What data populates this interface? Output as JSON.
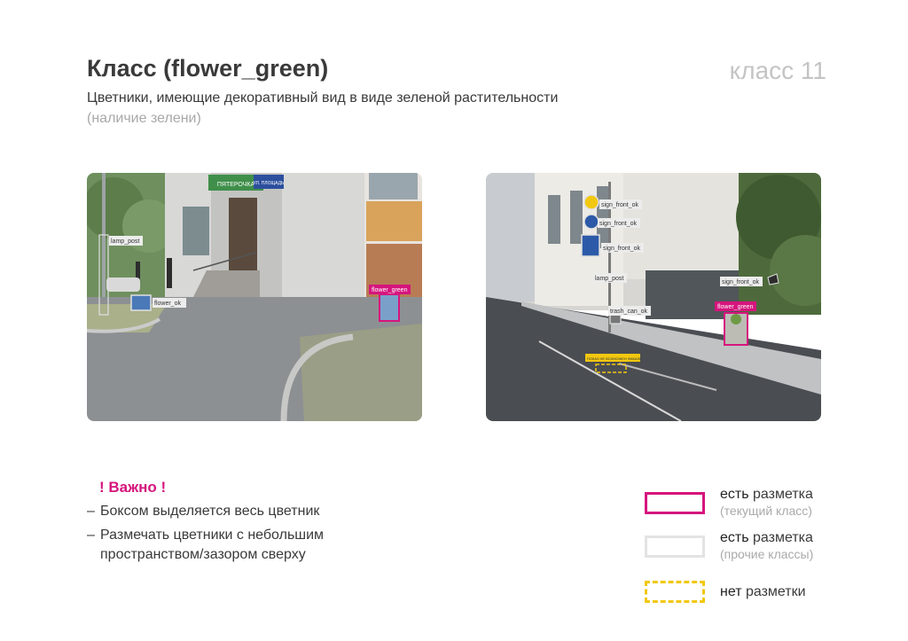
{
  "header": {
    "title": "Класс (flower_green)",
    "class_number": "класс 11",
    "subtitle": "Цветники, имеющие декоративный вид в виде зеленой растительности",
    "note": "(наличие зелени)"
  },
  "photos": {
    "left": {
      "labels": {
        "lamp_post": "lamp_post",
        "flower_ok": "flower_ok",
        "flower_green": "flower_green",
        "store_sign": "ПЯТЕРОЧКА",
        "street_plate": "УЛ. ПЛОЩАДЬ"
      }
    },
    "right": {
      "labels": {
        "sign1": "sign_front_ok",
        "sign2": "sign_front_ok",
        "sign3": "sign_front_ok",
        "sign4": "sign_front_ok",
        "lamp_post": "lamp_post",
        "trash": "trash_can_ok",
        "flower_green": "flower_green",
        "road_sign": "ПОКАЗ НЕ ВОЗМОЖЕН ФАКАЛЬ"
      }
    }
  },
  "notes": {
    "important": "! Важно !",
    "bullet_dash": "–",
    "bullet1": "Боксом выделяется весь цветник",
    "bullet2_line1": "Размечать цветники с небольшим",
    "bullet2_line2": "пространством/зазором сверху"
  },
  "legend": [
    {
      "bold": "есть",
      "text": " разметка",
      "sub": "(текущий класс)",
      "color": "#d6157d"
    },
    {
      "bold": "есть",
      "text": " разметка",
      "sub": "(прочие классы)",
      "color": "#e3e3e3"
    },
    {
      "bold": "нет",
      "text": " разметки",
      "sub": "",
      "color": "#f2c80f"
    }
  ],
  "colors": {
    "accent": "#d6157d",
    "other": "#e3e3e3",
    "none": "#f2c80f"
  }
}
